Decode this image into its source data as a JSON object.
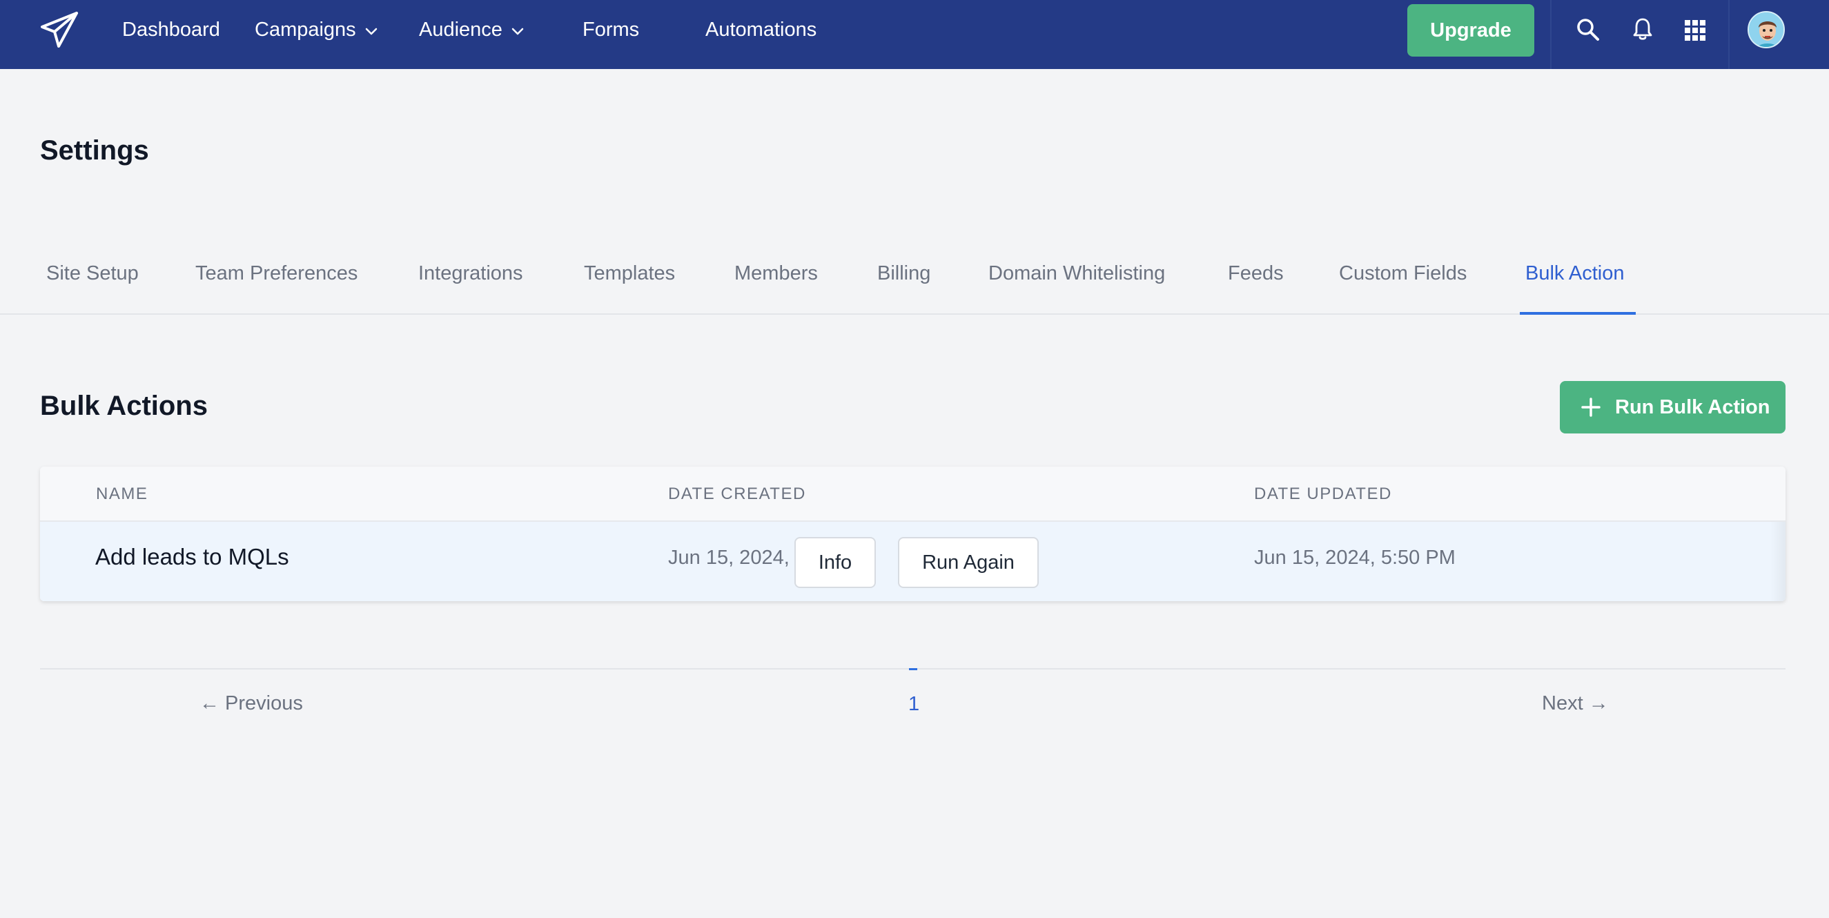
{
  "colors": {
    "nav_bg": "#243a86",
    "accent_green": "#4cb482",
    "accent_blue": "#2f6fe0",
    "page_bg": "#f3f4f6"
  },
  "topnav": {
    "logo_icon": "paper-plane-icon",
    "items": [
      {
        "label": "Dashboard",
        "has_dropdown": false
      },
      {
        "label": "Campaigns",
        "has_dropdown": true
      },
      {
        "label": "Audience",
        "has_dropdown": true
      },
      {
        "label": "Forms",
        "has_dropdown": false
      },
      {
        "label": "Automations",
        "has_dropdown": false
      }
    ],
    "upgrade_label": "Upgrade",
    "icons": [
      "search-icon",
      "bell-icon",
      "apps-grid-icon",
      "user-avatar"
    ]
  },
  "page": {
    "title": "Settings"
  },
  "tabs": {
    "items": [
      {
        "label": "Site Setup"
      },
      {
        "label": "Team Preferences"
      },
      {
        "label": "Integrations"
      },
      {
        "label": "Templates"
      },
      {
        "label": "Members"
      },
      {
        "label": "Billing"
      },
      {
        "label": "Domain Whitelisting"
      },
      {
        "label": "Feeds"
      },
      {
        "label": "Custom Fields"
      },
      {
        "label": "Bulk Action"
      }
    ],
    "active": "Bulk Action"
  },
  "bulk_actions": {
    "title": "Bulk Actions",
    "run_button_label": "Run Bulk Action",
    "columns": [
      "NAME",
      "DATE CREATED",
      "DATE UPDATED"
    ],
    "rows": [
      {
        "name": "Add leads to MQLs",
        "date_created": "Jun 15, 2024,",
        "date_updated": "Jun 15, 2024, 5:50 PM",
        "info_label": "Info",
        "run_again_label": "Run Again"
      }
    ]
  },
  "pagination": {
    "previous_label": "← Previous",
    "next_label": "Next →",
    "current_page": "1"
  }
}
